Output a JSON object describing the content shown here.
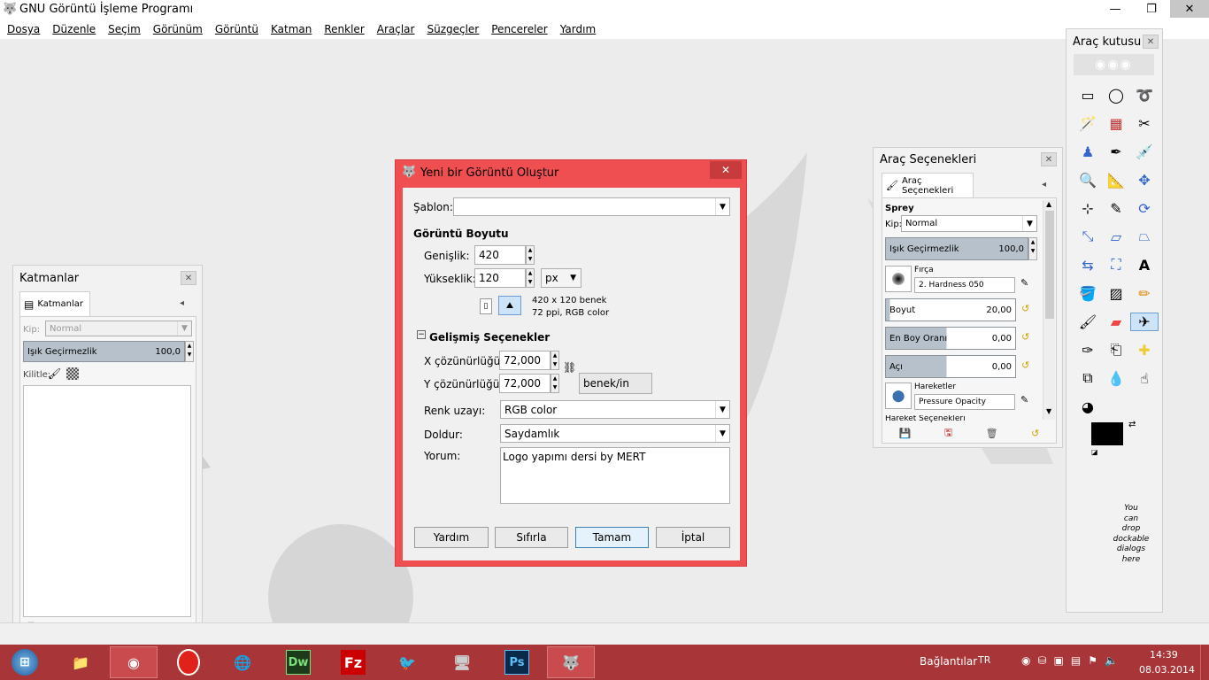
{
  "app": {
    "title": "GNU Görüntü İşleme Programı"
  },
  "menu": [
    "Dosya",
    "Düzenle",
    "Seçim",
    "Görünüm",
    "Görüntü",
    "Katman",
    "Renkler",
    "Araçlar",
    "Süzgeçler",
    "Pencereler",
    "Yardım"
  ],
  "layers": {
    "title": "Katmanlar",
    "tab": "Katmanlar",
    "mode_label": "Kip:",
    "mode_value": "Normal",
    "opacity_label": "Işık Geçirmezlik",
    "opacity_value": "100,0",
    "lock_label": "Kilitle:"
  },
  "dialog": {
    "title": "Yeni bir Görüntü Oluştur",
    "template_label": "Şablon:",
    "template_value": "",
    "size_section": "Görüntü Boyutu",
    "width_label": "Genişlik:",
    "width_value": "420",
    "height_label": "Yükseklik:",
    "height_value": "120",
    "unit": "px",
    "info_line1": "420 x 120 benek",
    "info_line2": "72 ppi, RGB color",
    "advanced_section": "Gelişmiş Seçenekler",
    "xres_label": "X çözünürlüğü:",
    "xres_value": "72,000",
    "yres_label": "Y çözünürlüğü:",
    "yres_value": "72,000",
    "res_unit": "benek/in",
    "colorspace_label": "Renk uzayı:",
    "colorspace_value": "RGB color",
    "fill_label": "Doldur:",
    "fill_value": "Saydamlık",
    "comment_label": "Yorum:",
    "comment_value": "Logo yapımı dersi by MERT",
    "btn_help": "Yardım",
    "btn_reset": "Sıfırla",
    "btn_ok": "Tamam",
    "btn_cancel": "İptal"
  },
  "tool_options": {
    "title": "Araç Seçenekleri",
    "tab": "Araç Seçenekleri",
    "tool_name": "Sprey",
    "mode_label": "Kip:",
    "mode_value": "Normal",
    "opacity_label": "Işık Geçirmezlik",
    "opacity_value": "100,0",
    "brush_label": "Fırça",
    "brush_value": "2. Hardness 050",
    "size_label": "Boyut",
    "size_value": "20,00",
    "aspect_label": "En Boy Oranı",
    "aspect_value": "0,00",
    "angle_label": "Açı",
    "angle_value": "0,00",
    "dynamics_label": "Hareketler",
    "dynamics_value": "Pressure Opacity",
    "dynamics_options": "Hareket Seçenekleri"
  },
  "toolbox": {
    "title": "Araç kutusu",
    "drop_hint": [
      "You",
      "can",
      "drop",
      "dockable",
      "dialogs",
      "here"
    ]
  },
  "taskbar": {
    "connections": "Bağlantılar",
    "lang": "TR",
    "time": "14:39",
    "date": "08.03.2014"
  },
  "colors": {
    "dialog_frame": "#f04f51",
    "taskbar": "#a83638",
    "bar_fill": "#b7c1cb",
    "fg_color": "#000000",
    "bg_color": "#ffffff"
  }
}
